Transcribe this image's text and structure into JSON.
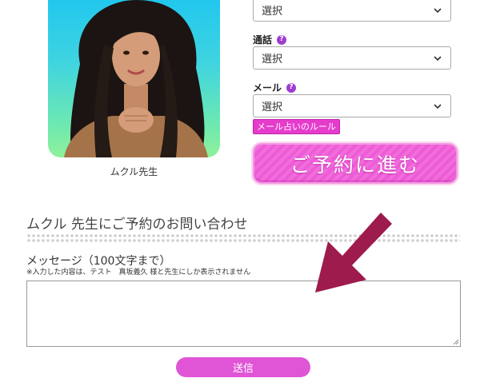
{
  "teacher": {
    "name": "ムクル先生"
  },
  "fields": {
    "top_select": {
      "value": "選択"
    },
    "call": {
      "label": "通話",
      "value": "選択"
    },
    "mail": {
      "label": "メール",
      "value": "選択"
    },
    "help_glyph": "?"
  },
  "rule_link": "メール占いのルール",
  "reserve_button": "ご予約に進む",
  "inquiry": {
    "title": "ムクル 先生にご予約のお問い合わせ",
    "message_label": "メッセージ（100文字まで）",
    "message_note": "※入力した内容は、テスト　真坂義久 様と先生にしか表示されません",
    "message_value": "",
    "send_button": "送信"
  },
  "colors": {
    "accent_pink": "#e63ccc",
    "annotation_arrow": "#9e1b4e",
    "help_purple": "#a03ccf"
  },
  "icons": [
    "chevron-down-icon",
    "help-icon",
    "arrow-annotation-icon",
    "resize-grip-icon"
  ]
}
